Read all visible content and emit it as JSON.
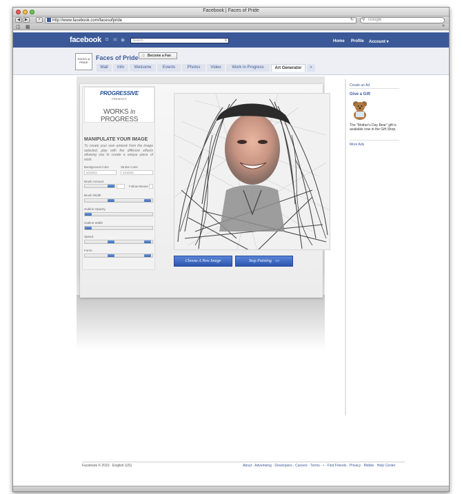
{
  "window": {
    "title": "Facebook | Faces of Pride",
    "url": "http://www.facebook.com/facesofpride",
    "search_placeholder": "Google"
  },
  "colors": {
    "facebook_blue": "#3b5998",
    "progressive_blue": "#1f4e9c",
    "button_blue": "#2c56b0"
  },
  "facebook": {
    "logo": "facebook",
    "search_placeholder": "Search",
    "nav": {
      "home": "Home",
      "profile": "Profile",
      "account": "Account ▾"
    }
  },
  "page": {
    "name": "Faces of Pride",
    "thumb_text": "FACES of PRIDE",
    "fan_button": "Become a Fan",
    "tabs": [
      {
        "label": "Wall"
      },
      {
        "label": "Info"
      },
      {
        "label": "Welcome"
      },
      {
        "label": "Events"
      },
      {
        "label": "Photos"
      },
      {
        "label": "Video"
      },
      {
        "label": "Work In Progress"
      },
      {
        "label": "Art Generator"
      },
      {
        "label": "»"
      }
    ]
  },
  "app": {
    "brand": "PROGRESSIVE",
    "presents": "PRESENTS",
    "series_pre": "WORKS",
    "series_in": "in",
    "series_post": "PROGRESS",
    "manipulate_title": "MANIPULATE YOUR IMAGE",
    "description": "To create your own artwork from the image selected, play with the different effects allowing you to create a unique piece of work.",
    "controls": {
      "background_color_label": "Background Color",
      "background_color_value": "#333333",
      "stroke_color_label": "Stroke Color",
      "stroke_color_value": "#333333",
      "brush_amount_label": "Brush Amount",
      "follow_mouse_label": "Follow Mouse",
      "brush_width_label": "Brush Width",
      "outline_opacity_label": "Outline Opacity",
      "outline_width_label": "Outline Width",
      "speed_label": "Speed",
      "force_label": "Force"
    },
    "choose_button": "Choose A New Image",
    "stop_button": "Stop Painting"
  },
  "sidebar": {
    "create_ad": "Create an Ad",
    "give_gift": "Give a Gift",
    "gift_text": "The \"Mother's Day Bear\" gift is available now in the Gift Shop.",
    "more_ads": "More Ads"
  },
  "footer": {
    "left": "Facebook © 2010 · English (US)",
    "links": "About · Advertising · Developers · Careers · Terms · • · Find Friends · Privacy · Mobile · Help Center"
  }
}
